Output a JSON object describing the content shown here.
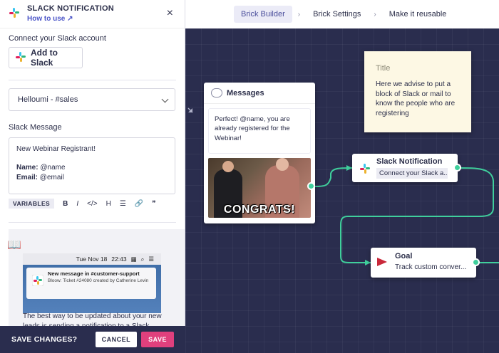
{
  "nav": {
    "steps": [
      "Brick Builder",
      "Brick Settings",
      "Make it reusable"
    ],
    "separator": "›"
  },
  "panel": {
    "title": "SLACK NOTIFICATION",
    "how_to_use": "How to use",
    "close": "×",
    "connect_label": "Connect your Slack account",
    "add_to_slack": "Add to Slack",
    "channel": "Helloumi - #sales",
    "slack_message_label": "Slack Message",
    "message_line1": "New Webinar Registrant!",
    "name_label": "Name:",
    "name_value": "@name",
    "email_label": "Email:",
    "email_value": "@email",
    "toolbar": {
      "variables": "VARIABLES",
      "bold": "B",
      "italic": "I",
      "code": "</>",
      "heading": "H",
      "list": "☰",
      "link": "🔗",
      "quote": "❞"
    },
    "preview": {
      "date": "Tue Nov 18",
      "time": "22:43",
      "notif_title": "New message in #customer-support",
      "notif_sub": "Bloow: Ticket #24080 created by Catherine Levin",
      "text": "The best way to be updated about your new leads is sending a notification to a Slack"
    },
    "footer": {
      "question": "SAVE CHANGES?",
      "cancel": "CANCEL",
      "save": "SAVE"
    }
  },
  "canvas": {
    "messages_node": {
      "title": "Messages",
      "text": "Perfect! @name, you are already registered for the Webinar!",
      "gif_caption": "CONGRATS!"
    },
    "note": {
      "title": "Title",
      "body": "Here we advise to put a block of Slack or mail to know the people who are registering"
    },
    "slack_node": {
      "title": "Slack Notification",
      "sub": "Connect your Slack a..."
    },
    "goal_node": {
      "title": "Goal",
      "sub": "Track custom conver..."
    }
  },
  "colors": {
    "canvas_bg": "#2a2d4e",
    "accent_green": "#3fcf9c",
    "save_pink": "#e0407d",
    "link_blue": "#4b55c8"
  }
}
